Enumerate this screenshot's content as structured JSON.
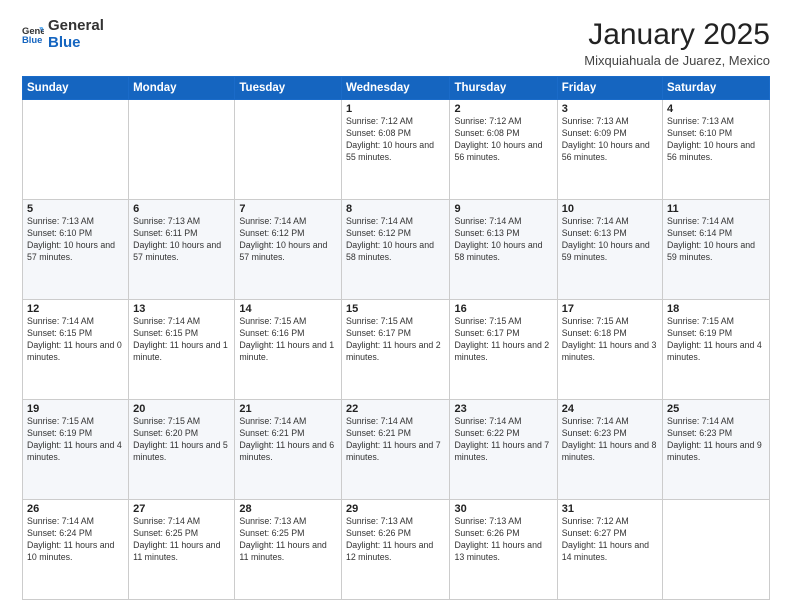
{
  "logo": {
    "general": "General",
    "blue": "Blue"
  },
  "header": {
    "title": "January 2025",
    "subtitle": "Mixquiahuala de Juarez, Mexico"
  },
  "columns": [
    "Sunday",
    "Monday",
    "Tuesday",
    "Wednesday",
    "Thursday",
    "Friday",
    "Saturday"
  ],
  "weeks": [
    [
      {
        "day": "",
        "info": ""
      },
      {
        "day": "",
        "info": ""
      },
      {
        "day": "",
        "info": ""
      },
      {
        "day": "1",
        "info": "Sunrise: 7:12 AM\nSunset: 6:08 PM\nDaylight: 10 hours and 55 minutes."
      },
      {
        "day": "2",
        "info": "Sunrise: 7:12 AM\nSunset: 6:08 PM\nDaylight: 10 hours and 56 minutes."
      },
      {
        "day": "3",
        "info": "Sunrise: 7:13 AM\nSunset: 6:09 PM\nDaylight: 10 hours and 56 minutes."
      },
      {
        "day": "4",
        "info": "Sunrise: 7:13 AM\nSunset: 6:10 PM\nDaylight: 10 hours and 56 minutes."
      }
    ],
    [
      {
        "day": "5",
        "info": "Sunrise: 7:13 AM\nSunset: 6:10 PM\nDaylight: 10 hours and 57 minutes."
      },
      {
        "day": "6",
        "info": "Sunrise: 7:13 AM\nSunset: 6:11 PM\nDaylight: 10 hours and 57 minutes."
      },
      {
        "day": "7",
        "info": "Sunrise: 7:14 AM\nSunset: 6:12 PM\nDaylight: 10 hours and 57 minutes."
      },
      {
        "day": "8",
        "info": "Sunrise: 7:14 AM\nSunset: 6:12 PM\nDaylight: 10 hours and 58 minutes."
      },
      {
        "day": "9",
        "info": "Sunrise: 7:14 AM\nSunset: 6:13 PM\nDaylight: 10 hours and 58 minutes."
      },
      {
        "day": "10",
        "info": "Sunrise: 7:14 AM\nSunset: 6:13 PM\nDaylight: 10 hours and 59 minutes."
      },
      {
        "day": "11",
        "info": "Sunrise: 7:14 AM\nSunset: 6:14 PM\nDaylight: 10 hours and 59 minutes."
      }
    ],
    [
      {
        "day": "12",
        "info": "Sunrise: 7:14 AM\nSunset: 6:15 PM\nDaylight: 11 hours and 0 minutes."
      },
      {
        "day": "13",
        "info": "Sunrise: 7:14 AM\nSunset: 6:15 PM\nDaylight: 11 hours and 1 minute."
      },
      {
        "day": "14",
        "info": "Sunrise: 7:15 AM\nSunset: 6:16 PM\nDaylight: 11 hours and 1 minute."
      },
      {
        "day": "15",
        "info": "Sunrise: 7:15 AM\nSunset: 6:17 PM\nDaylight: 11 hours and 2 minutes."
      },
      {
        "day": "16",
        "info": "Sunrise: 7:15 AM\nSunset: 6:17 PM\nDaylight: 11 hours and 2 minutes."
      },
      {
        "day": "17",
        "info": "Sunrise: 7:15 AM\nSunset: 6:18 PM\nDaylight: 11 hours and 3 minutes."
      },
      {
        "day": "18",
        "info": "Sunrise: 7:15 AM\nSunset: 6:19 PM\nDaylight: 11 hours and 4 minutes."
      }
    ],
    [
      {
        "day": "19",
        "info": "Sunrise: 7:15 AM\nSunset: 6:19 PM\nDaylight: 11 hours and 4 minutes."
      },
      {
        "day": "20",
        "info": "Sunrise: 7:15 AM\nSunset: 6:20 PM\nDaylight: 11 hours and 5 minutes."
      },
      {
        "day": "21",
        "info": "Sunrise: 7:14 AM\nSunset: 6:21 PM\nDaylight: 11 hours and 6 minutes."
      },
      {
        "day": "22",
        "info": "Sunrise: 7:14 AM\nSunset: 6:21 PM\nDaylight: 11 hours and 7 minutes."
      },
      {
        "day": "23",
        "info": "Sunrise: 7:14 AM\nSunset: 6:22 PM\nDaylight: 11 hours and 7 minutes."
      },
      {
        "day": "24",
        "info": "Sunrise: 7:14 AM\nSunset: 6:23 PM\nDaylight: 11 hours and 8 minutes."
      },
      {
        "day": "25",
        "info": "Sunrise: 7:14 AM\nSunset: 6:23 PM\nDaylight: 11 hours and 9 minutes."
      }
    ],
    [
      {
        "day": "26",
        "info": "Sunrise: 7:14 AM\nSunset: 6:24 PM\nDaylight: 11 hours and 10 minutes."
      },
      {
        "day": "27",
        "info": "Sunrise: 7:14 AM\nSunset: 6:25 PM\nDaylight: 11 hours and 11 minutes."
      },
      {
        "day": "28",
        "info": "Sunrise: 7:13 AM\nSunset: 6:25 PM\nDaylight: 11 hours and 11 minutes."
      },
      {
        "day": "29",
        "info": "Sunrise: 7:13 AM\nSunset: 6:26 PM\nDaylight: 11 hours and 12 minutes."
      },
      {
        "day": "30",
        "info": "Sunrise: 7:13 AM\nSunset: 6:26 PM\nDaylight: 11 hours and 13 minutes."
      },
      {
        "day": "31",
        "info": "Sunrise: 7:12 AM\nSunset: 6:27 PM\nDaylight: 11 hours and 14 minutes."
      },
      {
        "day": "",
        "info": ""
      }
    ]
  ]
}
